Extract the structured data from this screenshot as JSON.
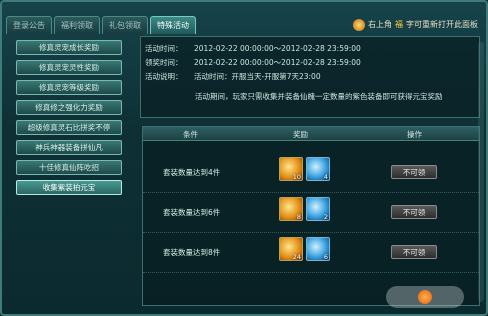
{
  "tabs": [
    {
      "label": "登录公告"
    },
    {
      "label": "福利领取"
    },
    {
      "label": "礼包领取"
    },
    {
      "label": "特殊活动"
    }
  ],
  "hint": {
    "pre": "右上角",
    "key": "福",
    "post": "字可重新打开此面板"
  },
  "sidebar": {
    "items": [
      "修真灵宠成长奖励",
      "修真灵宠灵性奖励",
      "修真灵宠等级奖励",
      "修真修之强化力奖励",
      "超级修真灵石比拼奖不停",
      "神兵神器装备拼仙凡",
      "十佳修真仙阵吃招",
      "收集紫装拍元宝"
    ]
  },
  "info": {
    "rows": [
      {
        "label": "活动时间：",
        "value": "2012-02-22   00:00:00～2012-02-28   23:59:00"
      },
      {
        "label": "领奖时间：",
        "value": "2012-02-22   00:00:00～2012-02-28   23:59:00"
      },
      {
        "label": "活动说明：",
        "value": "活动时间：开服当天-开服第7天23:00"
      }
    ],
    "desc": "活动期间，玩家只需收集并装备仙魄一定数量的紫色装备即可获得元宝奖励"
  },
  "table": {
    "headers": [
      "条件",
      "奖励",
      "操作"
    ],
    "rows": [
      {
        "condition": "套装数量达到4件",
        "gold_count": "10",
        "blue_count": "4",
        "button": "不可领"
      },
      {
        "condition": "套装数量达到6件",
        "gold_count": "8",
        "blue_count": "2",
        "button": "不可领"
      },
      {
        "condition": "套装数量达到8件",
        "gold_count": "24",
        "blue_count": "6",
        "button": "不可领"
      }
    ]
  }
}
